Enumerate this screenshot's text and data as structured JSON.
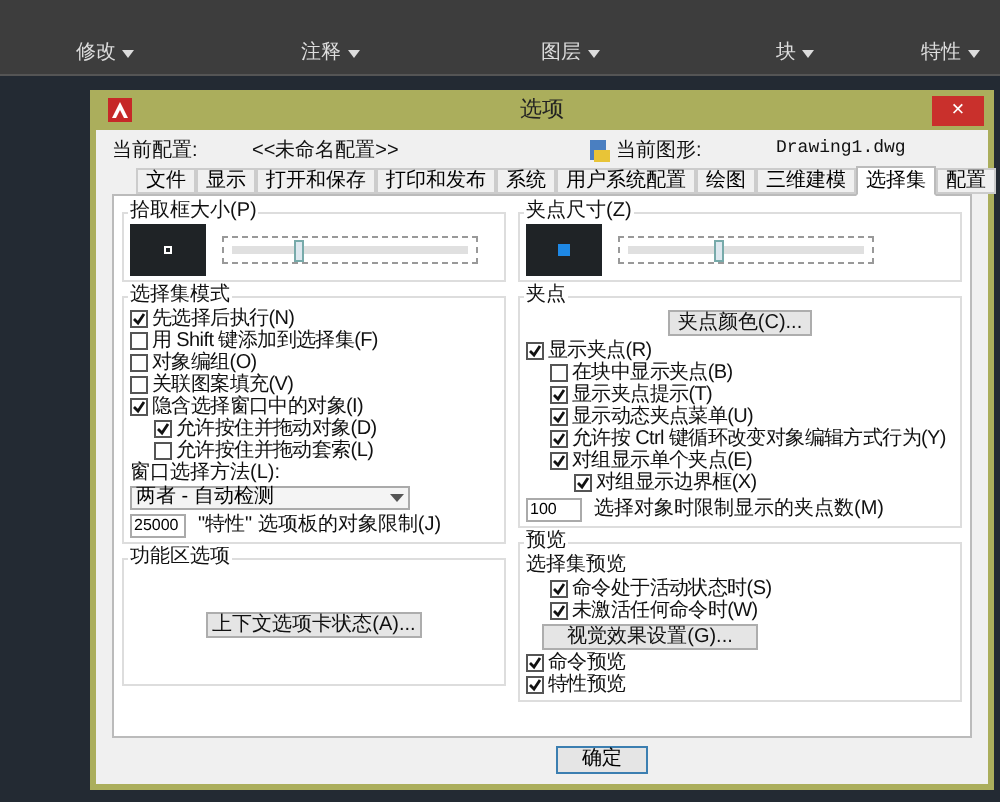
{
  "ribbon": {
    "panels": [
      {
        "label": "修改"
      },
      {
        "label": "注释"
      },
      {
        "label": "图层"
      },
      {
        "label": "块"
      },
      {
        "label": "特性"
      }
    ]
  },
  "dialog": {
    "title": "选项",
    "close": "×",
    "current_profile_label": "当前配置:",
    "current_profile": "<<未命名配置>>",
    "current_drawing_label": "当前图形:",
    "current_drawing": "Drawing1.dwg",
    "tabs": [
      {
        "label": "文件",
        "selected": false
      },
      {
        "label": "显示",
        "selected": false
      },
      {
        "label": "打开和保存",
        "selected": false
      },
      {
        "label": "打印和发布",
        "selected": false
      },
      {
        "label": "系统",
        "selected": false
      },
      {
        "label": "用户系统配置",
        "selected": false
      },
      {
        "label": "绘图",
        "selected": false
      },
      {
        "label": "三维建模",
        "selected": false
      },
      {
        "label": "选择集",
        "selected": true
      },
      {
        "label": "配置",
        "selected": false
      }
    ],
    "pickbox": {
      "title": "拾取框大小(P)",
      "level": 0.3
    },
    "selection_modes": {
      "title": "选择集模式",
      "options": [
        {
          "label": "先选择后执行(N)",
          "checked": true
        },
        {
          "label": "用 Shift 键添加到选择集(F)",
          "checked": false
        },
        {
          "label": "对象编组(O)",
          "checked": false
        },
        {
          "label": "关联图案填充(V)",
          "checked": false
        },
        {
          "label": "隐含选择窗口中的对象(I)",
          "checked": true,
          "children": [
            {
              "label": "允许按住并拖动对象(D)",
              "checked": true
            },
            {
              "label": "允许按住并拖动套索(L)",
              "checked": false
            }
          ]
        }
      ],
      "window_method_label": "窗口选择方法(L):",
      "window_method": "两者 - 自动检测",
      "limit_value": "25000",
      "limit_label": "\"特性\" 选项板的对象限制(J)"
    },
    "ribbon_options": {
      "title": "功能区选项",
      "button": "上下文选项卡状态(A)..."
    },
    "grip_size": {
      "title": "夹点尺寸(Z)",
      "level": 0.4
    },
    "grips": {
      "title": "夹点",
      "button": "夹点颜色(C)...",
      "options": [
        {
          "label": "显示夹点(R)",
          "checked": true,
          "children": [
            {
              "label": "在块中显示夹点(B)",
              "checked": false
            },
            {
              "label": "显示夹点提示(T)",
              "checked": true
            },
            {
              "label": "显示动态夹点菜单(U)",
              "checked": true
            },
            {
              "label": "允许按 Ctrl 键循环改变对象编辑方式行为(Y)",
              "checked": true
            },
            {
              "label": "对组显示单个夹点(E)",
              "checked": true,
              "children": [
                {
                  "label": "对组显示边界框(X)",
                  "checked": true
                }
              ]
            }
          ]
        }
      ],
      "limit_value": "100",
      "limit_label": "选择对象时限制显示的夹点数(M)"
    },
    "preview": {
      "title": "预览",
      "subtitle": "选择集预览",
      "options": [
        {
          "label": "命令处于活动状态时(S)",
          "checked": true
        },
        {
          "label": "未激活任何命令时(W)",
          "checked": true
        }
      ],
      "button": "视觉效果设置(G)...",
      "more_options": [
        {
          "label": "命令预览",
          "checked": true
        },
        {
          "label": "特性预览",
          "checked": true
        }
      ]
    },
    "buttons": [
      "确定"
    ]
  }
}
